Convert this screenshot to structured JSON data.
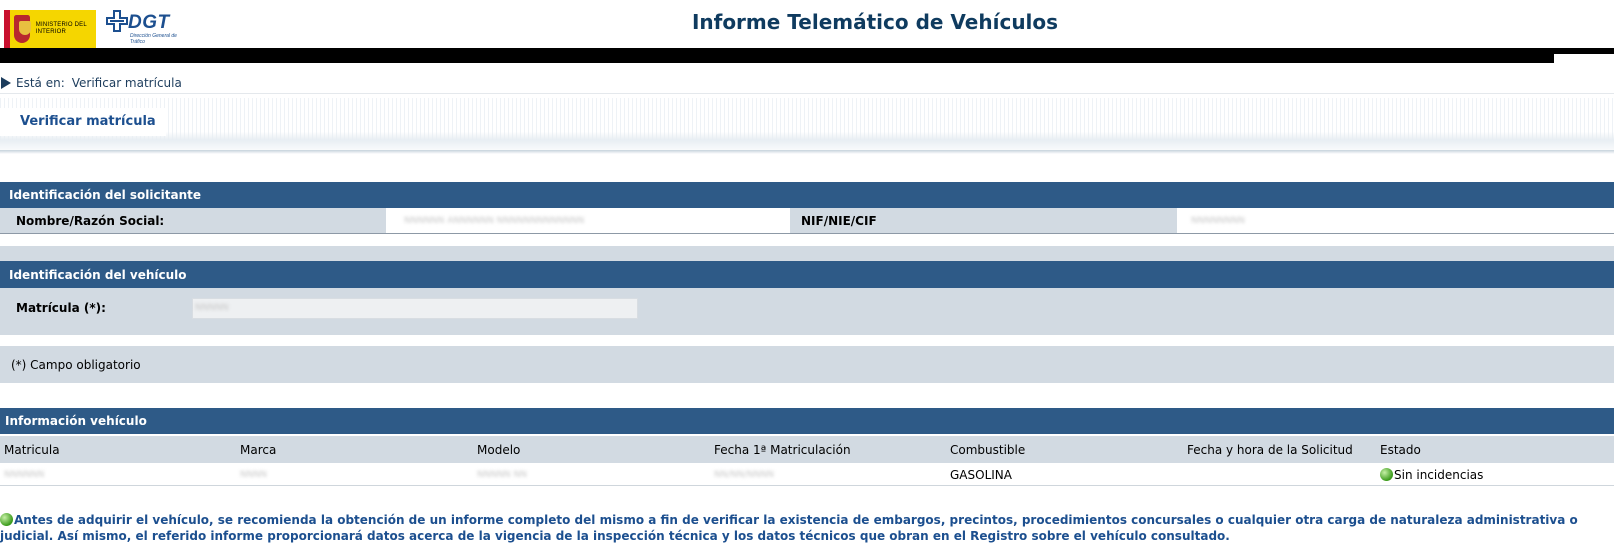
{
  "header": {
    "ministry_logo_text": "MINISTERIO DEL INTERIOR",
    "dgt_logo_text": "DGT",
    "dgt_logo_sub": "Dirección General de Tráfico",
    "title": "Informe Telemático de Vehículos"
  },
  "breadcrumb": {
    "label": "Está en:",
    "current": "Verificar matrícula"
  },
  "section_title": "Verificar matrícula",
  "applicant": {
    "heading": "Identificación del solicitante",
    "name_label": "Nombre/Razón Social:",
    "name_value": "NNNNNN ANNNNNN NNNNNNNNNNNNN",
    "nif_label": "NIF/NIE/CIF",
    "nif_value": "NNNNNNNN"
  },
  "vehicle_id": {
    "heading": "Identificación del vehículo",
    "plate_label": "Matrícula (*):",
    "plate_value": "NNNNN",
    "required_note": "(*) Campo obligatorio"
  },
  "vehicle_info": {
    "heading": "Información vehículo",
    "columns": [
      "Matricula",
      "Marca",
      "Modelo",
      "Fecha 1ª Matriculación",
      "Combustible",
      "Fecha y hora de la Solicitud",
      "Estado"
    ],
    "row": {
      "plate": "NNNNNN",
      "brand": "NNNN",
      "model": "NNNNN NN",
      "first_registration": "NN/NN/NNNN",
      "fuel": "GASOLINA",
      "request_datetime": "",
      "status": "Sin incidencias"
    }
  },
  "notice": "Antes de adquirir el vehículo, se recomienda la obtención de un informe completo del mismo a fin de verificar la existencia de embargos, precintos, procedimientos concursales o cualquier otra carga de naturaleza administrativa o judicial. Así mismo, el referido informe proporcionará datos acerca de la vigencia de la inspección técnica y los datos técnicos que obran en el Registro sobre el vehículo consultado.",
  "colors": {
    "bar": "#2e5a87",
    "title": "#0f3b5f",
    "link": "#1c4f8f",
    "grey_row": "#d2dae2",
    "status_ok": "#3a9a1a"
  }
}
